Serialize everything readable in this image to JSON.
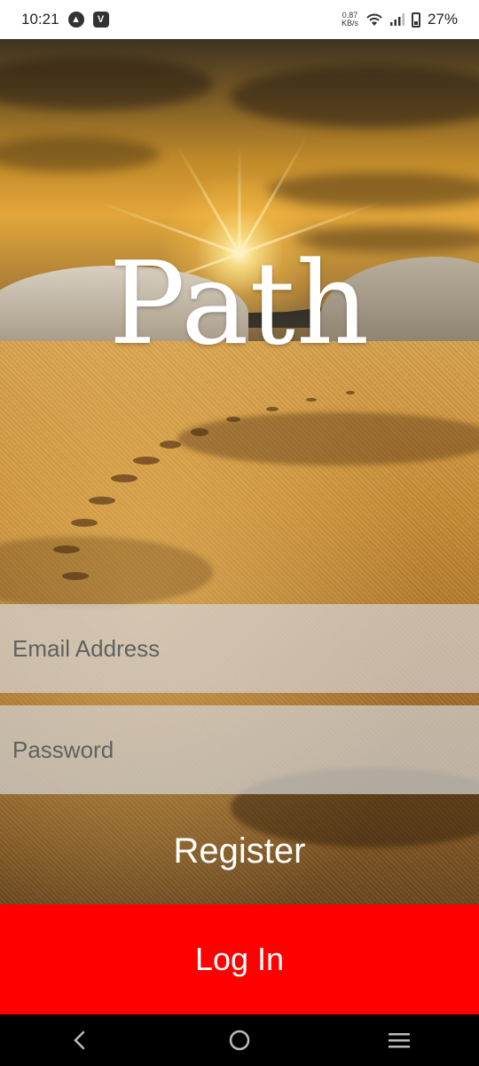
{
  "status_bar": {
    "time": "10:21",
    "notification_icons": [
      "nav-icon",
      "v-icon"
    ],
    "net_speed_value": "0.87",
    "net_speed_unit": "KB/s",
    "battery_percent": "27%",
    "battery_level": 0.27
  },
  "app": {
    "title": "Path"
  },
  "form": {
    "email_placeholder": "Email Address",
    "email_value": "",
    "password_placeholder": "Password",
    "password_value": ""
  },
  "actions": {
    "register_label": "Register",
    "login_label": "Log In"
  },
  "colors": {
    "login_button": "#ff0000",
    "field_overlay": "#d2d2d2",
    "title_text": "#ffffff"
  },
  "nav_bar": {
    "buttons": [
      "back-icon",
      "home-icon",
      "menu-icon"
    ]
  }
}
